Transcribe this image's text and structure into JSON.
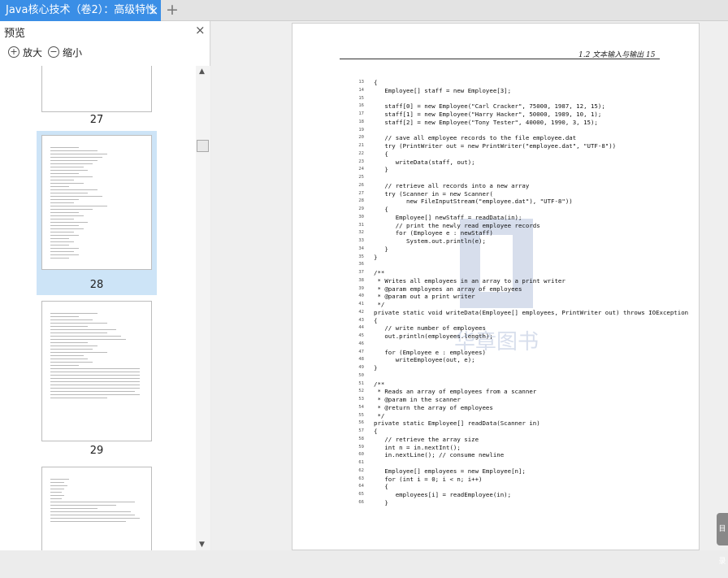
{
  "tab": {
    "title": "Java核心技术（卷2）：高级特性",
    "close_glyph": "×",
    "add_glyph": "+"
  },
  "preview": {
    "title": "预览",
    "close_glyph": "×",
    "zoom_in": "放大",
    "zoom_out": "缩小",
    "zoom_in_glyph": "+",
    "zoom_out_glyph": "−",
    "scroll_up_glyph": "▲",
    "scroll_down_glyph": "▼",
    "pages": [
      "27",
      "28",
      "29"
    ],
    "selected_page": "28"
  },
  "document": {
    "header": "1.2  文本输入与输出   15",
    "code": [
      {
        "n": "13",
        "t": "{"
      },
      {
        "n": "14",
        "t": "   Employee[] staff = new Employee[3];"
      },
      {
        "n": "15",
        "t": ""
      },
      {
        "n": "16",
        "t": "   staff[0] = new Employee(\"Carl Cracker\", 75000, 1987, 12, 15);"
      },
      {
        "n": "17",
        "t": "   staff[1] = new Employee(\"Harry Hacker\", 50000, 1989, 10, 1);"
      },
      {
        "n": "18",
        "t": "   staff[2] = new Employee(\"Tony Tester\", 40000, 1990, 3, 15);"
      },
      {
        "n": "19",
        "t": ""
      },
      {
        "n": "20",
        "t": "   // save all employee records to the file employee.dat"
      },
      {
        "n": "21",
        "t": "   try (PrintWriter out = new PrintWriter(\"employee.dat\", \"UTF-8\"))"
      },
      {
        "n": "22",
        "t": "   {"
      },
      {
        "n": "23",
        "t": "      writeData(staff, out);"
      },
      {
        "n": "24",
        "t": "   }"
      },
      {
        "n": "25",
        "t": ""
      },
      {
        "n": "26",
        "t": "   // retrieve all records into a new array"
      },
      {
        "n": "27",
        "t": "   try (Scanner in = new Scanner("
      },
      {
        "n": "28",
        "t": "         new FileInputStream(\"employee.dat\"), \"UTF-8\"))"
      },
      {
        "n": "29",
        "t": "   {"
      },
      {
        "n": "30",
        "t": "      Employee[] newStaff = readData(in);"
      },
      {
        "n": "31",
        "t": "      // print the newly read employee records"
      },
      {
        "n": "32",
        "t": "      for (Employee e : newStaff)"
      },
      {
        "n": "33",
        "t": "         System.out.println(e);"
      },
      {
        "n": "34",
        "t": "   }"
      },
      {
        "n": "35",
        "t": "}"
      },
      {
        "n": "36",
        "t": ""
      },
      {
        "n": "37",
        "t": "/**"
      },
      {
        "n": "38",
        "t": " * Writes all employees in an array to a print writer"
      },
      {
        "n": "39",
        "t": " * @param employees an array of employees"
      },
      {
        "n": "40",
        "t": " * @param out a print writer"
      },
      {
        "n": "41",
        "t": " */"
      },
      {
        "n": "42",
        "t": "private static void writeData(Employee[] employees, PrintWriter out) throws IOException"
      },
      {
        "n": "43",
        "t": "{"
      },
      {
        "n": "44",
        "t": "   // write number of employees"
      },
      {
        "n": "45",
        "t": "   out.println(employees.length);"
      },
      {
        "n": "46",
        "t": ""
      },
      {
        "n": "47",
        "t": "   for (Employee e : employees)"
      },
      {
        "n": "48",
        "t": "      writeEmployee(out, e);"
      },
      {
        "n": "49",
        "t": "}"
      },
      {
        "n": "50",
        "t": ""
      },
      {
        "n": "51",
        "t": "/**"
      },
      {
        "n": "52",
        "t": " * Reads an array of employees from a scanner"
      },
      {
        "n": "53",
        "t": " * @param in the scanner"
      },
      {
        "n": "54",
        "t": " * @return the array of employees"
      },
      {
        "n": "55",
        "t": " */"
      },
      {
        "n": "56",
        "t": "private static Employee[] readData(Scanner in)"
      },
      {
        "n": "57",
        "t": "{"
      },
      {
        "n": "58",
        "t": "   // retrieve the array size"
      },
      {
        "n": "59",
        "t": "   int n = in.nextInt();"
      },
      {
        "n": "60",
        "t": "   in.nextLine(); // consume newline"
      },
      {
        "n": "61",
        "t": ""
      },
      {
        "n": "62",
        "t": "   Employee[] employees = new Employee[n];"
      },
      {
        "n": "63",
        "t": "   for (int i = 0; i < n; i++)"
      },
      {
        "n": "64",
        "t": "   {"
      },
      {
        "n": "65",
        "t": "      employees[i] = readEmployee(in);"
      },
      {
        "n": "66",
        "t": "   }"
      }
    ],
    "watermark": "华章图书",
    "side_tab": "目录"
  },
  "colors": {
    "tab_active": "#3a8ee6",
    "selection": "#cde4f7"
  }
}
